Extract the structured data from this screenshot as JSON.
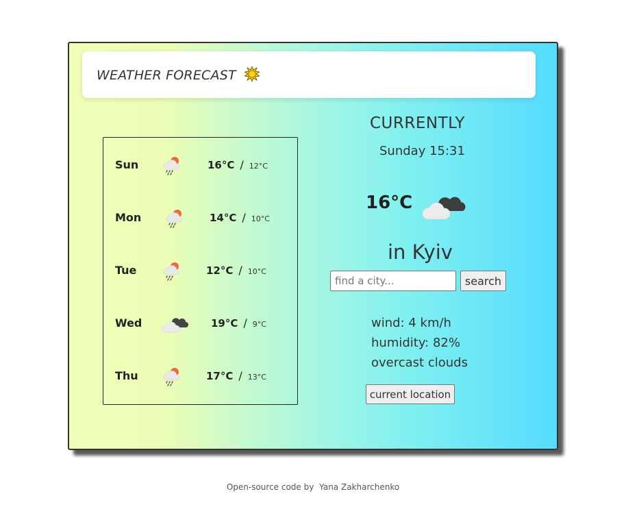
{
  "header": {
    "title": "WEATHER FORECAST",
    "icon": "sun-icon"
  },
  "forecast": [
    {
      "day": "Sun",
      "high": "16°C",
      "sep": "/",
      "low": "12°C",
      "icon": "rain-sun-icon"
    },
    {
      "day": "Mon",
      "high": "14°C",
      "sep": "/",
      "low": "10°C",
      "icon": "rain-sun-icon"
    },
    {
      "day": "Tue",
      "high": "12°C",
      "sep": "/",
      "low": "10°C",
      "icon": "rain-sun-icon"
    },
    {
      "day": "Wed",
      "high": "19°C",
      "sep": "/",
      "low": "9°C",
      "icon": "cloudy-icon"
    },
    {
      "day": "Thu",
      "high": "17°C",
      "sep": "/",
      "low": "13°C",
      "icon": "rain-sun-icon"
    }
  ],
  "current": {
    "heading": "CURRENTLY",
    "time": "Sunday 15:31",
    "temp": "16°C",
    "icon": "overcast-clouds-icon",
    "city": "in Kyiv",
    "wind": "wind: 4 km/h",
    "humidity": "humidity: 82%",
    "description": "overcast clouds"
  },
  "search": {
    "placeholder": "find a city...",
    "button_label": "search"
  },
  "location_button": "current location",
  "footer": {
    "text": "Open-source code by",
    "author": "Yana Zakharchenko"
  },
  "colors": {
    "gradient_left": "#f0ffb8",
    "gradient_mid": "#a6f7e3",
    "gradient_right": "#55dcff"
  }
}
